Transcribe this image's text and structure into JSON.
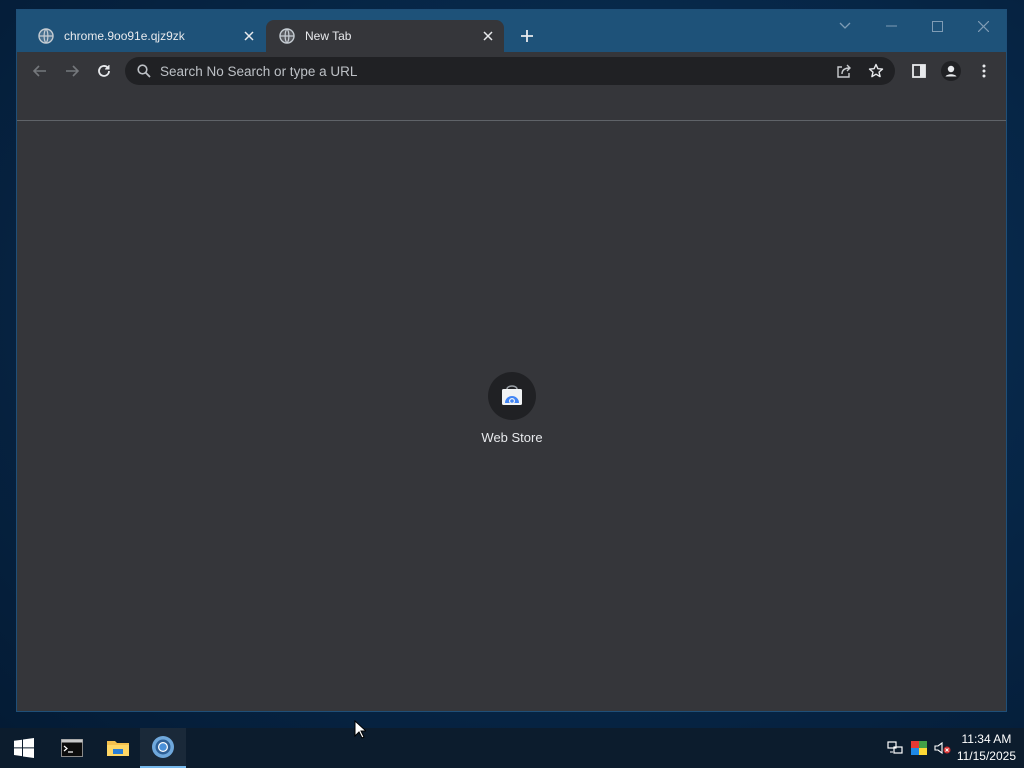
{
  "browser": {
    "tabs": [
      {
        "title": "chrome.9oo91e.qjz9zk",
        "active": false
      },
      {
        "title": "New Tab",
        "active": true
      }
    ],
    "omnibox": {
      "placeholder": "Search No Search or type a URL",
      "value": ""
    },
    "shortcuts": [
      {
        "label": "Web Store",
        "icon": "web-store-icon"
      }
    ]
  },
  "taskbar": {
    "pinned": [
      "start-icon",
      "terminal-icon",
      "file-explorer-icon",
      "chrome-icon"
    ],
    "tray_icons": [
      "network-icon",
      "color-icon",
      "volume-muted-icon"
    ],
    "time": "11:34 AM",
    "date": "11/15/2025"
  },
  "colors": {
    "tabstrip": "#1e5279",
    "toolbar": "#35363a",
    "omnibox": "#202124",
    "taskbar": "#0c1c2d",
    "accent": "#76b9ed"
  }
}
